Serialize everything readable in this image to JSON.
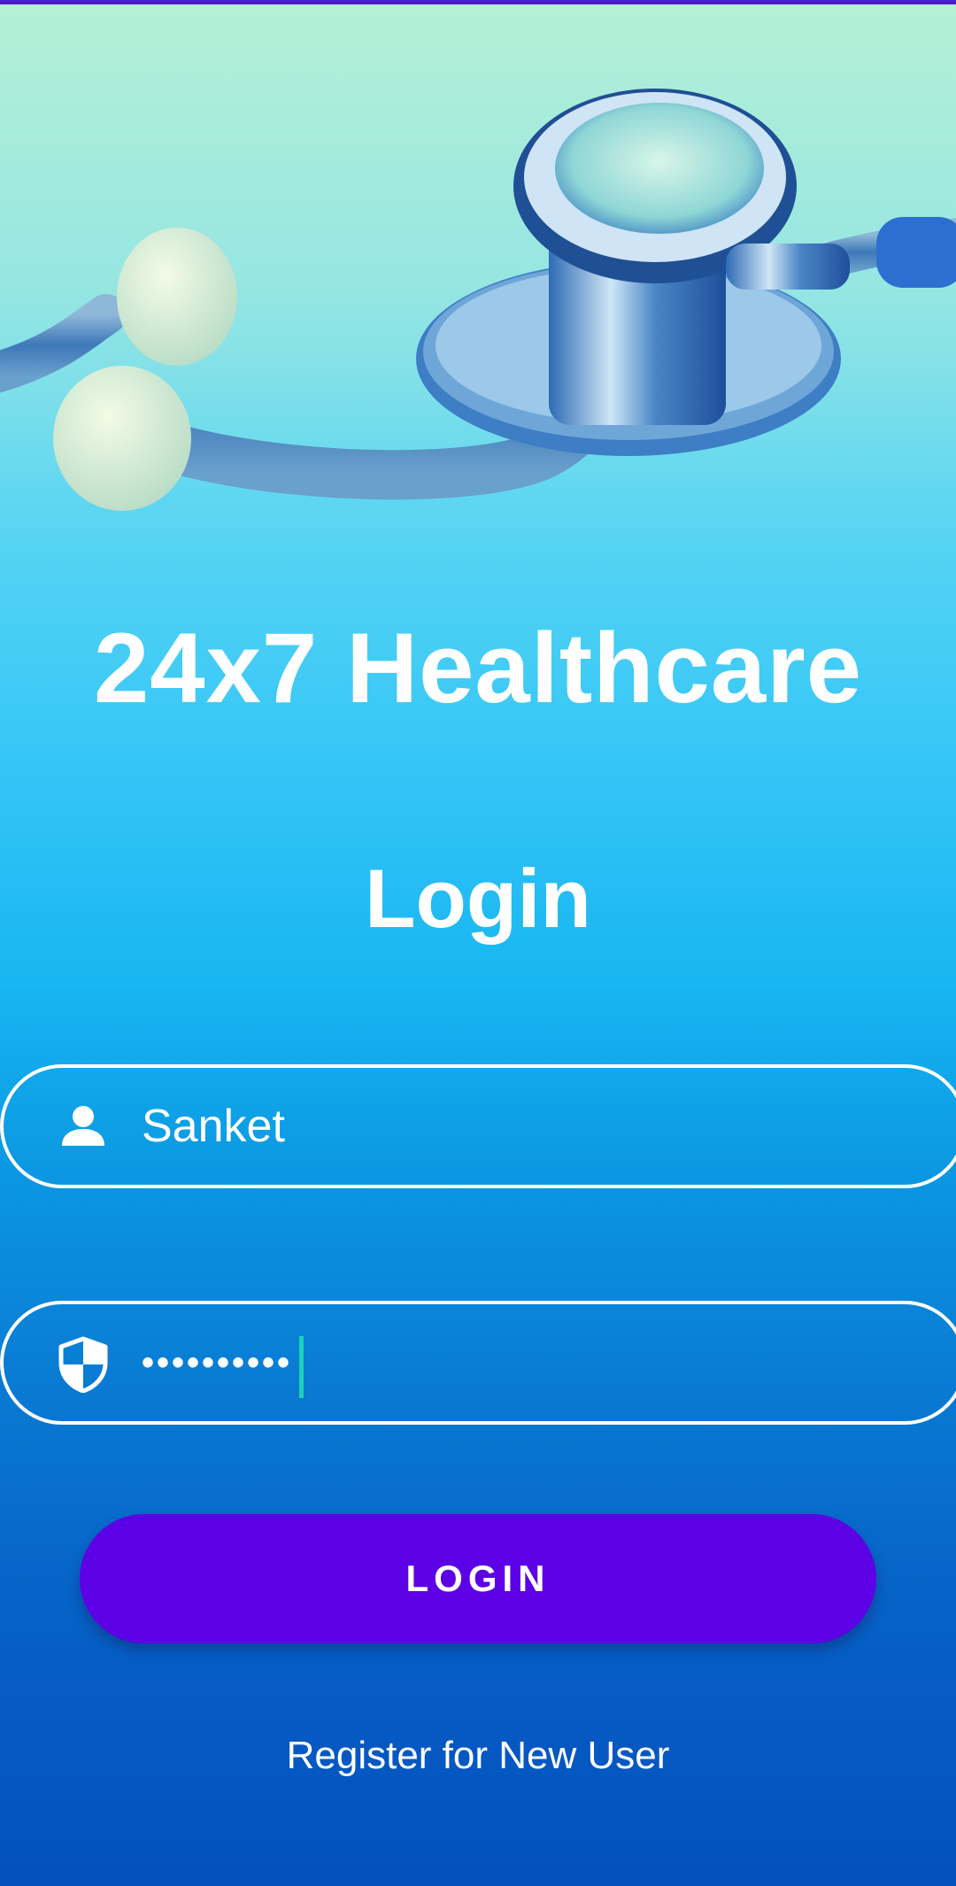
{
  "app": {
    "title": "24x7 Healthcare"
  },
  "page": {
    "heading": "Login"
  },
  "hero": {
    "image": "stethoscope-image"
  },
  "form": {
    "username": {
      "value": "Sanket",
      "icon": "person-icon"
    },
    "password": {
      "masked_value": "••••••••••",
      "icon": "shield-icon"
    },
    "login_button_label": "LOGIN",
    "register_link_label": "Register for New User"
  },
  "colors": {
    "button": "#5c00e6",
    "caret": "#1ad3b5",
    "text": "#ffffff"
  }
}
